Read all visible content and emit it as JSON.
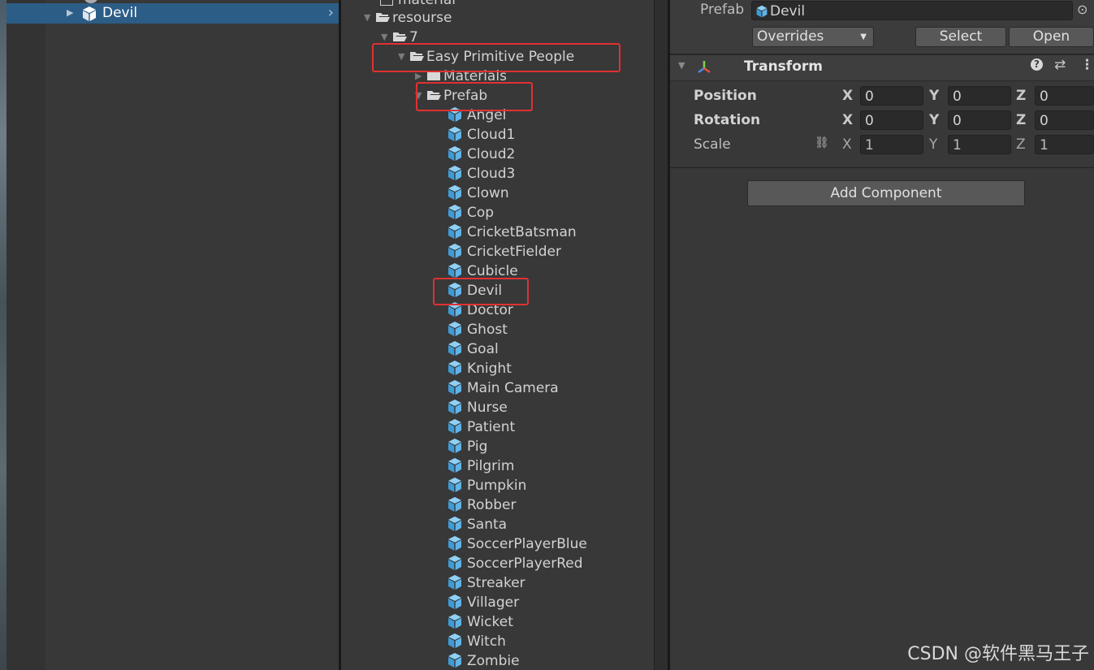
{
  "hierarchy": {
    "selected_item": "Devil"
  },
  "project": {
    "partial_top_label": "material",
    "folders": {
      "resourse": "resourse",
      "seven": "7",
      "easy": "Easy Primitive People",
      "materials": "Materials",
      "prefab": "Prefab"
    },
    "prefabs": [
      "Angel",
      "Cloud1",
      "Cloud2",
      "Cloud3",
      "Clown",
      "Cop",
      "CricketBatsman",
      "CricketFielder",
      "Cubicle",
      "Devil",
      "Doctor",
      "Ghost",
      "Goal",
      "Knight",
      "Main Camera",
      "Nurse",
      "Patient",
      "Pig",
      "Pilgrim",
      "Pumpkin",
      "Robber",
      "Santa",
      "SoccerPlayerBlue",
      "SoccerPlayerRed",
      "Streaker",
      "Villager",
      "Wicket",
      "Witch",
      "Zombie"
    ]
  },
  "inspector": {
    "prefab_label": "Prefab",
    "prefab_value": "Devil",
    "overrides_label": "Overrides",
    "select_label": "Select",
    "open_label": "Open",
    "component_title": "Transform",
    "position_label": "Position",
    "rotation_label": "Rotation",
    "scale_label": "Scale",
    "axes": [
      "X",
      "Y",
      "Z"
    ],
    "position": [
      "0",
      "0",
      "0"
    ],
    "rotation": [
      "0",
      "0",
      "0"
    ],
    "scale": [
      "1",
      "1",
      "1"
    ],
    "add_component_label": "Add Component"
  },
  "watermark": "CSDN @软件黑马王子",
  "colors": {
    "selection": "#2c5d87",
    "highlight_box": "#e03131",
    "prefab_icon": "#5fb4e8"
  }
}
